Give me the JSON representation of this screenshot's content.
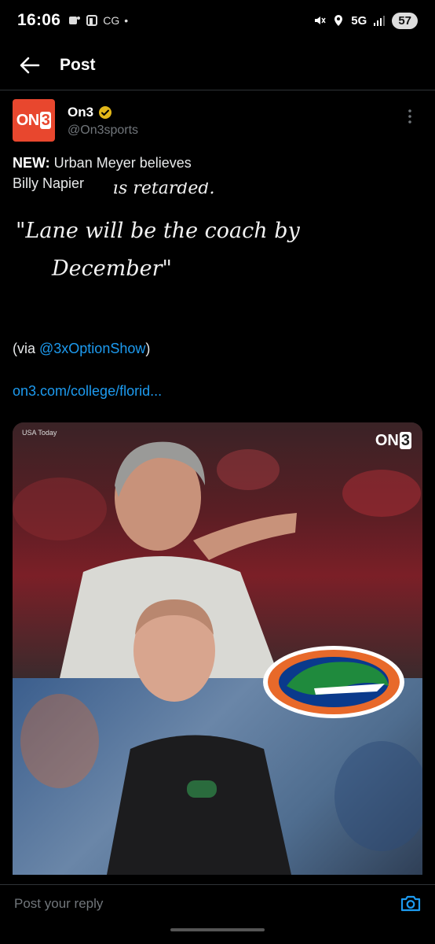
{
  "status_bar": {
    "time": "16:06",
    "carrier_badge": "CG",
    "network": "5G",
    "battery": "57"
  },
  "header": {
    "title": "Post"
  },
  "post": {
    "author_name": "On3",
    "author_handle": "@On3sports",
    "avatar_text": "ON",
    "avatar_num": "3",
    "text_prefix": "NEW:",
    "text_body": " Urban Meyer believes",
    "text_line2": "Billy Napier",
    "handwritten_line1": "is retarded.",
    "handwritten_line2": "\"Lane will be the coach by",
    "handwritten_line3": "December\"",
    "via_prefix": "(via ",
    "via_mention": "@3xOptionShow",
    "via_suffix": ")",
    "link": "on3.com/college/florid...",
    "media": {
      "photo_credit": "USA Today",
      "watermark_text": "ON",
      "watermark_num": "3"
    }
  },
  "reply": {
    "placeholder": "Post your reply"
  },
  "colors": {
    "accent": "#1d9bf0",
    "brand": "#e8472e",
    "verified": "#e2b719",
    "background": "#000000"
  }
}
